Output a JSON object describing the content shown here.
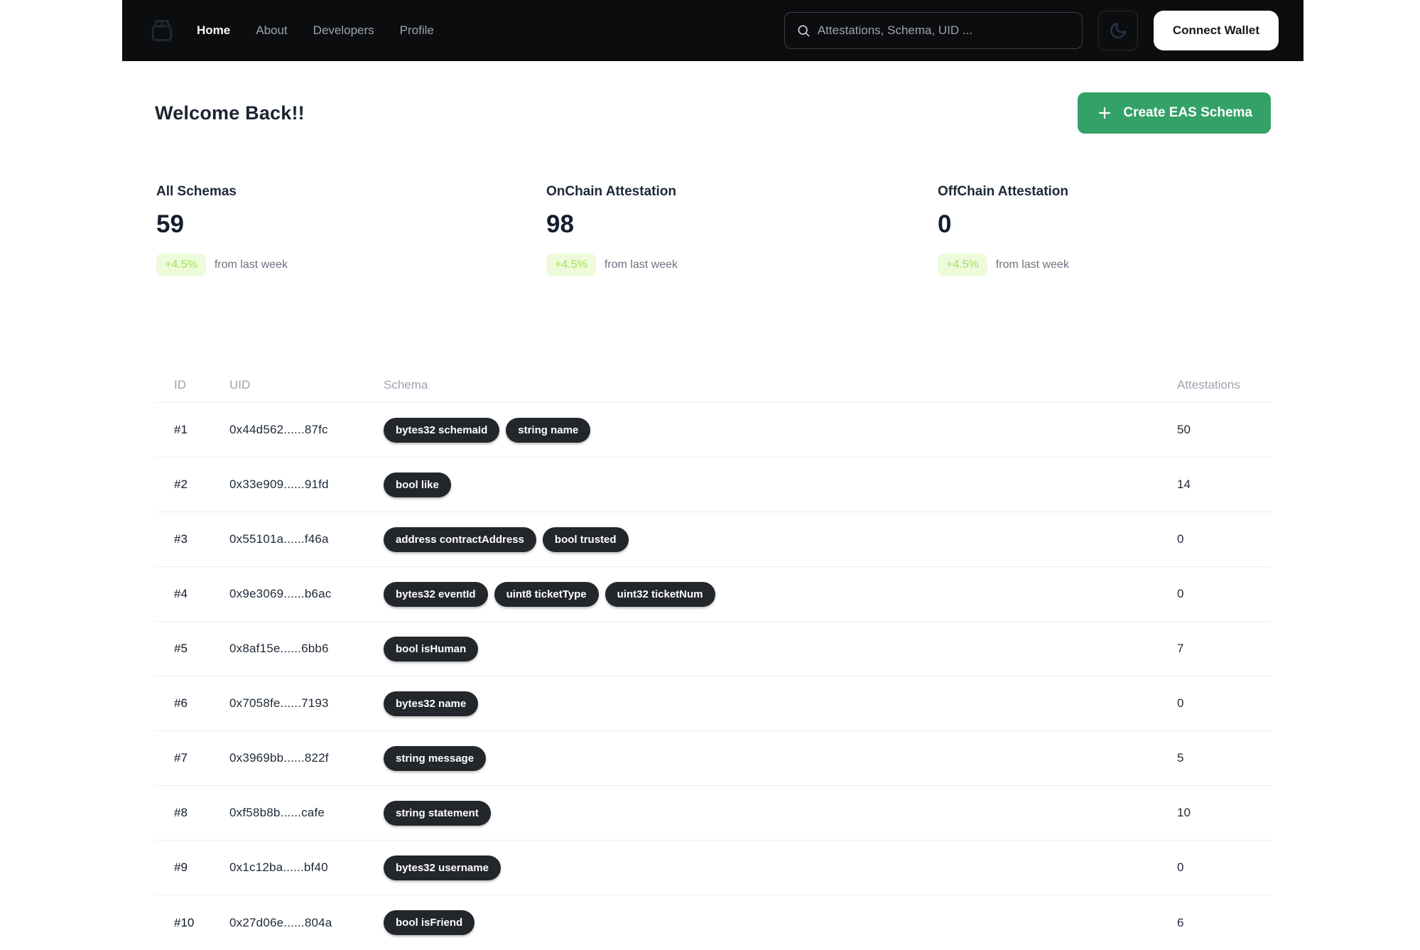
{
  "navbar": {
    "logo_icon": "package-icon",
    "links": [
      {
        "label": "Home",
        "active": true
      },
      {
        "label": "About",
        "active": false
      },
      {
        "label": "Developers",
        "active": false
      },
      {
        "label": "Profile",
        "active": false
      }
    ],
    "search": {
      "icon": "search-icon",
      "placeholder": "Attestations, Schema, UID ...",
      "value": ""
    },
    "theme_toggle_icon": "moon-icon",
    "connect_wallet_label": "Connect Wallet"
  },
  "hero": {
    "title": "Welcome Back!!",
    "create_button": {
      "icon": "plus-icon",
      "label": "Create EAS Schema"
    }
  },
  "stats": [
    {
      "label": "All Schemas",
      "value": "59",
      "change": "+4.5%",
      "note": "from last week"
    },
    {
      "label": "OnChain Attestation",
      "value": "98",
      "change": "+4.5%",
      "note": "from last week"
    },
    {
      "label": "OffChain Attestation",
      "value": "0",
      "change": "+4.5%",
      "note": "from last week"
    }
  ],
  "table": {
    "columns": {
      "id": "ID",
      "uid": "UID",
      "schema": "Schema",
      "attestations": "Attestations"
    },
    "rows": [
      {
        "id": "#1",
        "uid": "0x44d562......87fc",
        "schema": [
          "bytes32 schemaId",
          "string name"
        ],
        "attestations": "50"
      },
      {
        "id": "#2",
        "uid": "0x33e909......91fd",
        "schema": [
          "bool like"
        ],
        "attestations": "14"
      },
      {
        "id": "#3",
        "uid": "0x55101a......f46a",
        "schema": [
          "address contractAddress",
          "bool trusted"
        ],
        "attestations": "0"
      },
      {
        "id": "#4",
        "uid": "0x9e3069......b6ac",
        "schema": [
          "bytes32 eventId",
          "uint8 ticketType",
          "uint32 ticketNum"
        ],
        "attestations": "0"
      },
      {
        "id": "#5",
        "uid": "0x8af15e......6bb6",
        "schema": [
          "bool isHuman"
        ],
        "attestations": "7"
      },
      {
        "id": "#6",
        "uid": "0x7058fe......7193",
        "schema": [
          "bytes32 name"
        ],
        "attestations": "0"
      },
      {
        "id": "#7",
        "uid": "0x3969bb......822f",
        "schema": [
          "string message"
        ],
        "attestations": "5"
      },
      {
        "id": "#8",
        "uid": "0xf58b8b......cafe",
        "schema": [
          "string statement"
        ],
        "attestations": "10"
      },
      {
        "id": "#9",
        "uid": "0x1c12ba......bf40",
        "schema": [
          "bytes32 username"
        ],
        "attestations": "0"
      },
      {
        "id": "#10",
        "uid": "0x27d06e......804a",
        "schema": [
          "bool isFriend"
        ],
        "attestations": "6"
      }
    ]
  },
  "colors": {
    "navbar_bg": "#0c0d0f",
    "accent_green": "#34a169",
    "badge_bg": "#edfbdb",
    "badge_text": "#a6e05c",
    "chip_bg": "#23262b",
    "divider": "#e9eef5"
  }
}
